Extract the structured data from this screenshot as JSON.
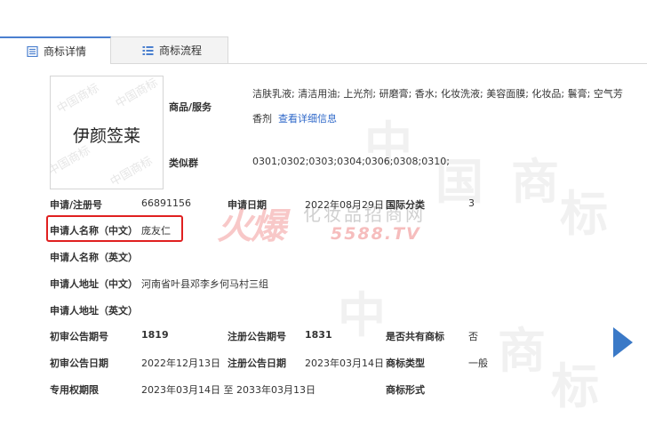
{
  "tabs": [
    {
      "label": "商标详情",
      "icon": "document-icon",
      "active": true
    },
    {
      "label": "商标流程",
      "icon": "list-icon",
      "active": false
    }
  ],
  "trademark": {
    "image_text": "伊颜签莱",
    "watermark_text": "中国商标"
  },
  "goods": {
    "label": "商品/服务",
    "value": "洁肤乳液; 清洁用油; 上光剂; 研磨膏; 香水; 化妆洗液; 美容面膜; 化妆品; 鬟膏; 空气芳",
    "value_line2": "香剂",
    "link": "查看详细信息"
  },
  "similar_group": {
    "label": "类似群",
    "value": "0301;0302;0303;0304;0306;0308;0310;"
  },
  "details": {
    "reg_no_label": "申请/注册号",
    "reg_no": "66891156",
    "apply_date_label": "申请日期",
    "apply_date": "2022年08月29日",
    "intl_class_label": "国际分类",
    "intl_class": "3",
    "applicant_cn_label": "申请人名称（中文）",
    "applicant_cn": "庞友仁",
    "applicant_en_label": "申请人名称（英文）",
    "address_cn_label": "申请人地址（中文）",
    "address_cn": "河南省叶县邓李乡何马村三组",
    "address_en_label": "申请人地址（英文）",
    "prelim_no_label": "初审公告期号",
    "prelim_no": "1819",
    "reg_notice_no_label": "注册公告期号",
    "reg_notice_no": "1831",
    "shared_label": "是否共有商标",
    "shared": "否",
    "prelim_date_label": "初审公告日期",
    "prelim_date": "2022年12月13日",
    "reg_notice_date_label": "注册公告日期",
    "reg_notice_date": "2023年03月14日",
    "tm_type_label": "商标类型",
    "tm_type": "一般",
    "exclusive_label": "专用权期限",
    "exclusive": "2023年03月14日 至 2033年03月13日",
    "tm_form_label": "商标形式"
  },
  "watermark": {
    "logo": "火爆",
    "site_name": "化妆品招商网",
    "site_url": "5588.TV",
    "bg_chars": [
      "中",
      "国",
      "商",
      "标"
    ]
  },
  "colors": {
    "accent": "#4a7fcf",
    "highlight": "#e02020",
    "link": "#2f68c9",
    "arrow": "#3a79c7"
  }
}
